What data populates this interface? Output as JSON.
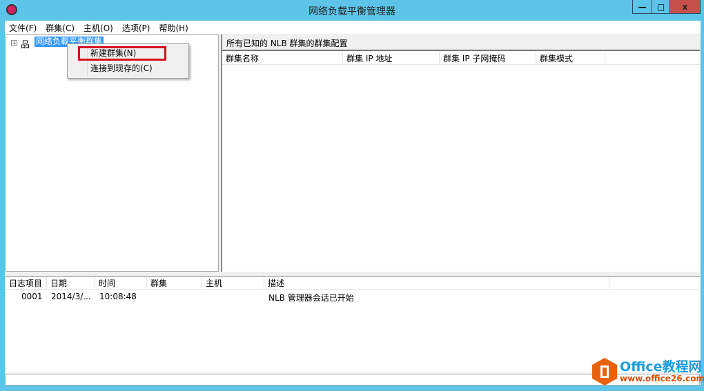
{
  "window": {
    "title": "网络负载平衡管理器",
    "minimize": "—",
    "maximize": "□",
    "close": "x"
  },
  "menu": [
    "文件(F)",
    "群集(C)",
    "主机(O)",
    "选项(P)",
    "帮助(H)"
  ],
  "tree": {
    "expander": "⊞",
    "root": "网络负载平衡群集"
  },
  "context_menu": {
    "items": [
      "新建群集(N)",
      "连接到现存的(C)"
    ],
    "highlighted": "新建群集(N)"
  },
  "cluster_panel": {
    "header": "所有已知的 NLB 群集的群集配置",
    "columns": [
      "群集名称",
      "群集 IP 地址",
      "群集 IP 子网掩码",
      "群集模式"
    ]
  },
  "log": {
    "columns": [
      "日志项目",
      "日期",
      "时间",
      "群集",
      "主机",
      "描述"
    ],
    "rows": [
      {
        "id": "0001",
        "date": "2014/3/...",
        "time": "10:08:48",
        "cluster": "",
        "host": "",
        "desc": "NLB 管理器会话已开始"
      }
    ]
  },
  "watermark": {
    "name": "Office教程网",
    "url": "www.office26.com"
  },
  "colors": {
    "titlebar": "#5ec3e9",
    "close": "#c7504a",
    "selection": "#3399ff",
    "highlight_box": "#d4101c"
  }
}
